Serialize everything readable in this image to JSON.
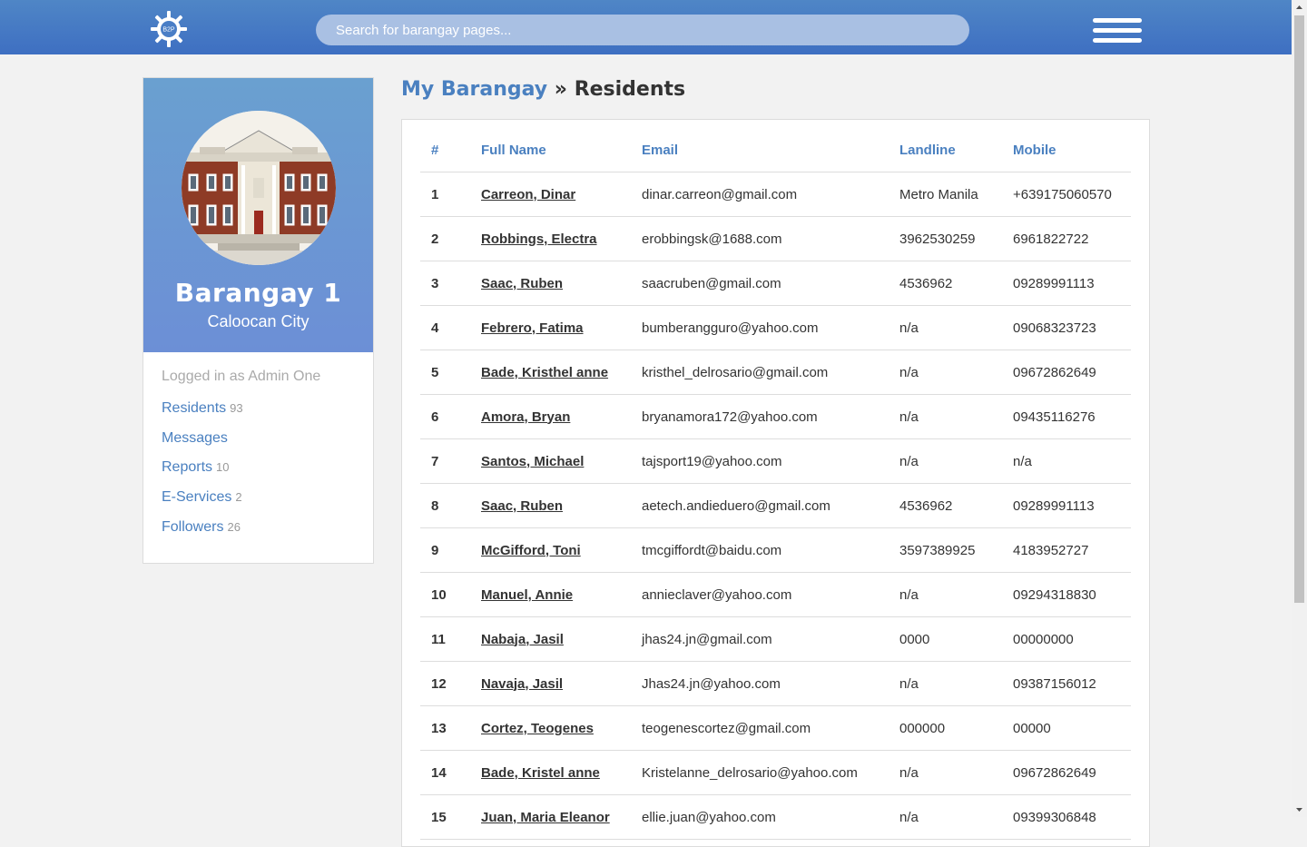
{
  "header": {
    "logo_text": "B2P",
    "search_placeholder": "Search for barangay pages..."
  },
  "sidebar": {
    "barangay_name": "Barangay 1",
    "city": "Caloocan City",
    "logged_in_text": "Logged in as Admin One",
    "items": [
      {
        "label": "Residents",
        "count": "93"
      },
      {
        "label": "Messages",
        "count": ""
      },
      {
        "label": "Reports",
        "count": "10"
      },
      {
        "label": "E-Services",
        "count": "2"
      },
      {
        "label": "Followers",
        "count": "26"
      }
    ]
  },
  "breadcrumb": {
    "parent": "My Barangay",
    "separator": "»",
    "current": "Residents"
  },
  "table": {
    "headers": [
      "#",
      "Full Name",
      "Email",
      "Landline",
      "Mobile"
    ],
    "rows": [
      {
        "num": "1",
        "name": "Carreon, Dinar",
        "email": "dinar.carreon@gmail.com",
        "landline": "Metro Manila",
        "mobile": "+639175060570"
      },
      {
        "num": "2",
        "name": "Robbings, Electra",
        "email": "erobbingsk@1688.com",
        "landline": "3962530259",
        "mobile": "6961822722"
      },
      {
        "num": "3",
        "name": "Saac, Ruben",
        "email": "saacruben@gmail.com",
        "landline": "4536962",
        "mobile": "09289991113"
      },
      {
        "num": "4",
        "name": "Febrero, Fatima",
        "email": "bumberangguro@yahoo.com",
        "landline": "n/a",
        "mobile": "09068323723"
      },
      {
        "num": "5",
        "name": "Bade, Kristhel anne",
        "email": "kristhel_delrosario@gmail.com",
        "landline": "n/a",
        "mobile": "09672862649"
      },
      {
        "num": "6",
        "name": "Amora, Bryan",
        "email": "bryanamora172@yahoo.com",
        "landline": "n/a",
        "mobile": "09435116276"
      },
      {
        "num": "7",
        "name": "Santos, Michael",
        "email": "tajsport19@yahoo.com",
        "landline": "n/a",
        "mobile": "n/a"
      },
      {
        "num": "8",
        "name": "Saac, Ruben",
        "email": "aetech.andieduero@gmail.com",
        "landline": "4536962",
        "mobile": "09289991113"
      },
      {
        "num": "9",
        "name": "McGifford, Toni",
        "email": "tmcgiffordt@baidu.com",
        "landline": "3597389925",
        "mobile": "4183952727"
      },
      {
        "num": "10",
        "name": "Manuel, Annie",
        "email": "annieclaver@yahoo.com",
        "landline": "n/a",
        "mobile": "09294318830"
      },
      {
        "num": "11",
        "name": "Nabaja, Jasil",
        "email": "jhas24.jn@gmail.com",
        "landline": "0000",
        "mobile": "00000000"
      },
      {
        "num": "12",
        "name": "Navaja, Jasil",
        "email": "Jhas24.jn@yahoo.com",
        "landline": "n/a",
        "mobile": "09387156012"
      },
      {
        "num": "13",
        "name": "Cortez, Teogenes",
        "email": "teogenescortez@gmail.com",
        "landline": "000000",
        "mobile": "00000"
      },
      {
        "num": "14",
        "name": "Bade, Kristel anne",
        "email": "Kristelanne_delrosario@yahoo.com",
        "landline": "n/a",
        "mobile": "09672862649"
      },
      {
        "num": "15",
        "name": "Juan, Maria Eleanor",
        "email": "ellie.juan@yahoo.com",
        "landline": "n/a",
        "mobile": "09399306848"
      }
    ]
  },
  "colors": {
    "header_blue": "#4a7ec6",
    "link_blue": "#4a80c0",
    "page_bg": "#f2f2f2"
  },
  "icons": {
    "logo": "gear-logo-icon",
    "menu": "hamburger-menu-icon"
  }
}
